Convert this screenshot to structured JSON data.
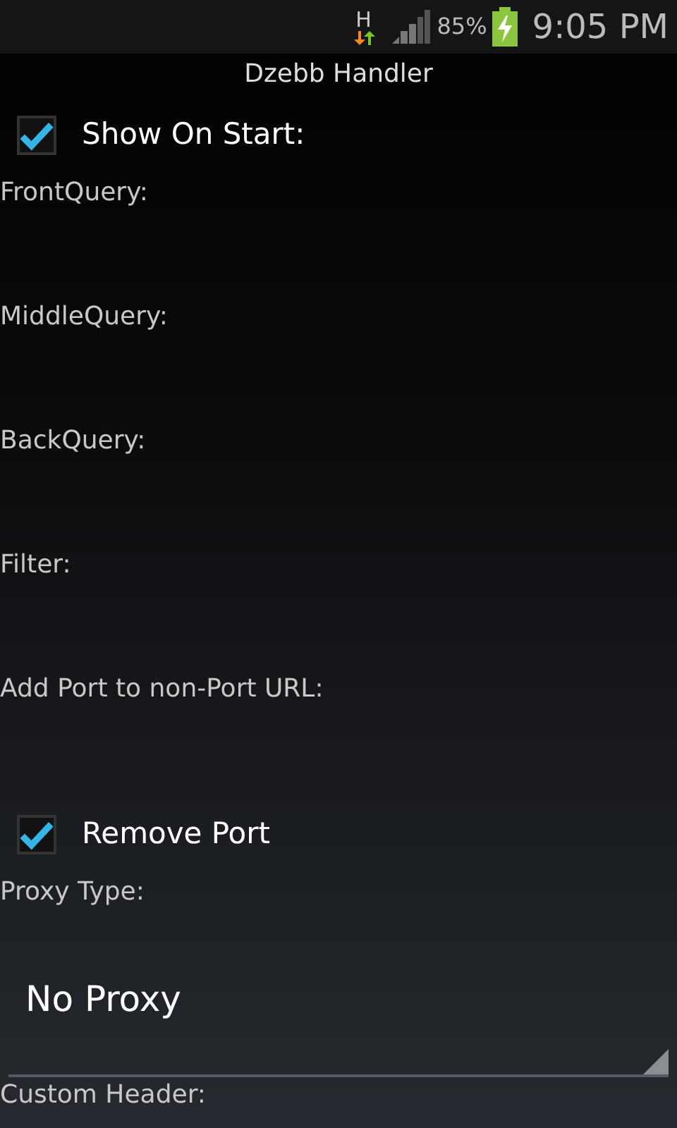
{
  "status_bar": {
    "network": "H",
    "battery": "85%",
    "time": "9:05 PM"
  },
  "title": "Dzebb Handler",
  "items": [
    {
      "kind": "checkbox",
      "label": "Show On Start:",
      "checked": true
    },
    {
      "kind": "field",
      "label": "FrontQuery:"
    },
    {
      "kind": "field",
      "label": "MiddleQuery:"
    },
    {
      "kind": "field",
      "label": "BackQuery:"
    },
    {
      "kind": "field",
      "label": "Filter:"
    },
    {
      "kind": "field",
      "label": "Add Port to non-Port URL:"
    },
    {
      "kind": "checkbox",
      "label": "Remove Port",
      "checked": true
    },
    {
      "kind": "label",
      "label": "Proxy Type:"
    },
    {
      "kind": "spinner",
      "value": "No Proxy"
    },
    {
      "kind": "label",
      "label": "Custom Header:"
    }
  ]
}
